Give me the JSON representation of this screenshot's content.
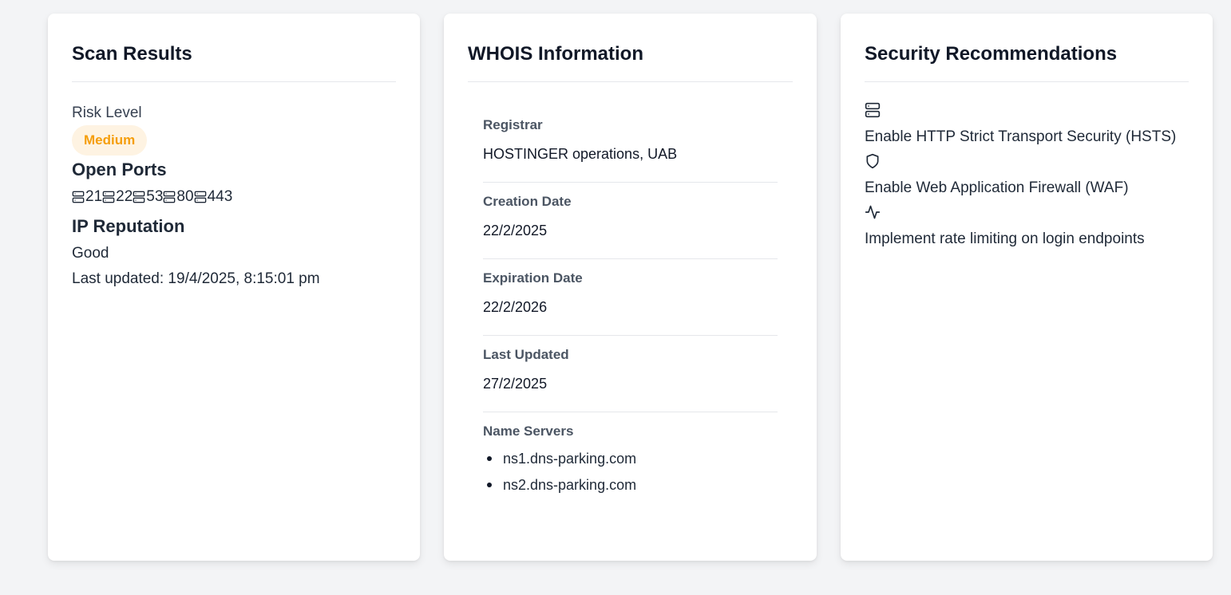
{
  "scan": {
    "title": "Scan Results",
    "risk_label": "Risk Level",
    "risk_value": "Medium",
    "ports_heading": "Open Ports",
    "ports": [
      "21",
      "22",
      "53",
      "80",
      "443"
    ],
    "reputation_heading": "IP Reputation",
    "reputation_value": "Good",
    "last_updated": "Last updated: 19/4/2025, 8:15:01 pm"
  },
  "whois": {
    "title": "WHOIS Information",
    "registrar_label": "Registrar",
    "registrar_value": "HOSTINGER operations, UAB",
    "creation_label": "Creation Date",
    "creation_value": "22/2/2025",
    "expiration_label": "Expiration Date",
    "expiration_value": "22/2/2026",
    "updated_label": "Last Updated",
    "updated_value": "27/2/2025",
    "ns_label": "Name Servers",
    "name_servers": [
      "ns1.dns-parking.com",
      "ns2.dns-parking.com"
    ]
  },
  "recommendations": {
    "title": "Security Recommendations",
    "items": [
      {
        "icon": "server-icon",
        "text": "Enable HTTP Strict Transport Security (HSTS)"
      },
      {
        "icon": "shield-icon",
        "text": "Enable Web Application Firewall (WAF)"
      },
      {
        "icon": "activity-icon",
        "text": "Implement rate limiting on login endpoints"
      }
    ]
  },
  "colors": {
    "badge_bg": "#fef3e2",
    "badge_text": "#f59e0b",
    "page_bg": "#f3f4f6"
  }
}
